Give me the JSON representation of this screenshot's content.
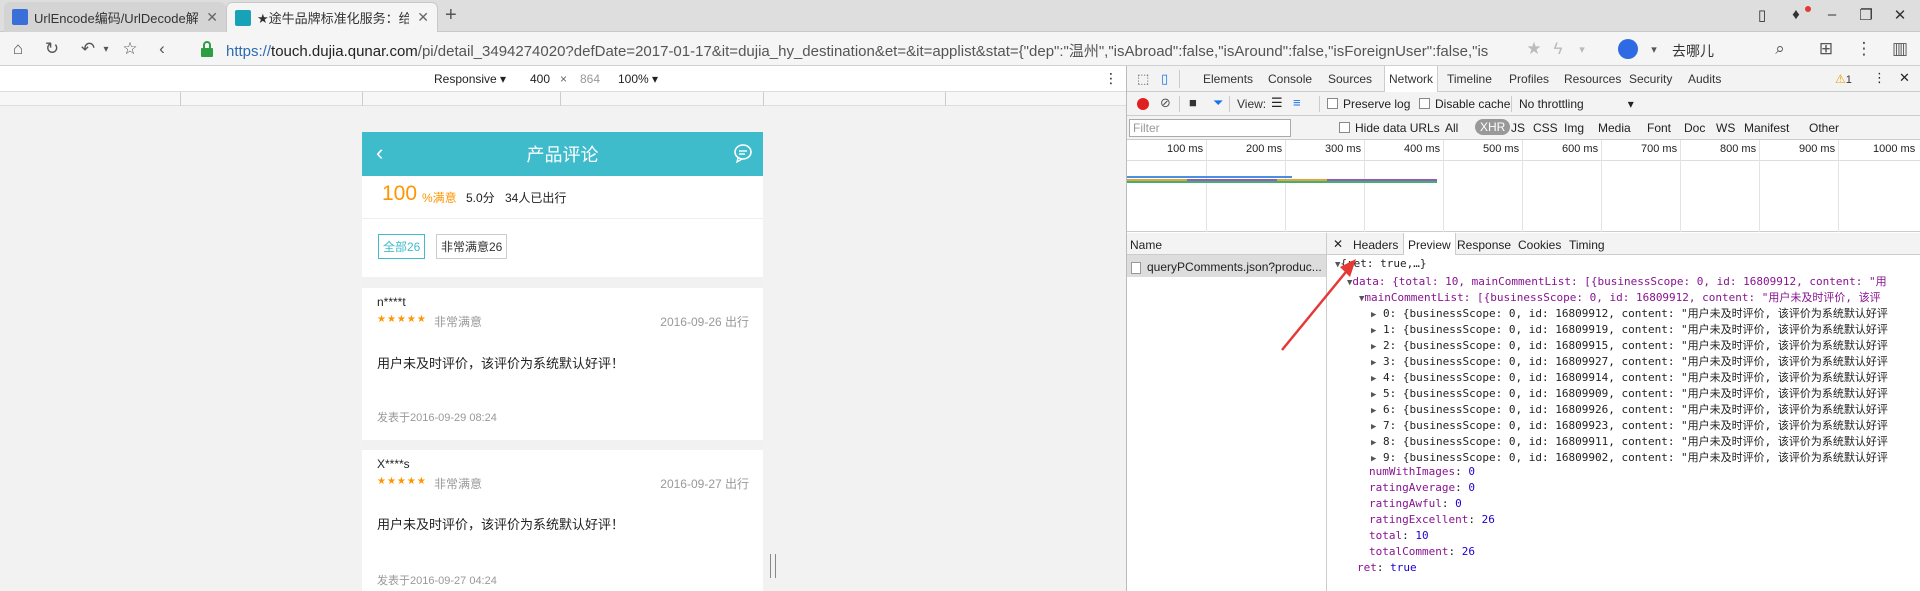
{
  "browser": {
    "tabs": [
      {
        "title": "UrlEncode编码/UrlDecode解",
        "active": false
      },
      {
        "title": "★途牛品牌标准化服务：给您",
        "active": true
      }
    ],
    "url_scheme": "https://",
    "url_domain": "touch.dujia.qunar.com",
    "url_rest": "/pi/detail_3494274020?defDate=2017-01-17&it=dujia_hy_destination&et=&it=applist&stat={\"dep\":\"温州\",\"isAbroad\":false,\"isAround\":false,\"isForeignUser\":false,\"is",
    "search_label": "去哪儿"
  },
  "device_toolbar": {
    "mode": "Responsive",
    "width": "400",
    "height": "864",
    "zoom": "100%"
  },
  "app": {
    "title": "产品评论",
    "score_percent": "100",
    "score_percent_unit": "%满意",
    "score": "5.0分",
    "travelers": "34人已出行",
    "filters": [
      "全部26",
      "非常满意26"
    ],
    "reviews": [
      {
        "user": "n****t",
        "stars": "★★★★★",
        "rating": "非常满意",
        "trip_date": "2016-09-26 出行",
        "content": "用户未及时评价，该评价为系统默认好评！",
        "posted": "发表于2016-09-29 08:24"
      },
      {
        "user": "X****s",
        "stars": "★★★★★",
        "rating": "非常满意",
        "trip_date": "2016-09-27 出行",
        "content": "用户未及时评价，该评价为系统默认好评！",
        "posted": "发表于2016-09-27 04:24"
      }
    ]
  },
  "devtools": {
    "tabs": [
      "Elements",
      "Console",
      "Sources",
      "Network",
      "Timeline",
      "Profiles",
      "Resources",
      "Security",
      "Audits"
    ],
    "active_tab": "Network",
    "warning_count": "1",
    "view_label": "View:",
    "preserve_log": "Preserve log",
    "disable_cache": "Disable cache",
    "throttling": "No throttling",
    "filter_placeholder": "Filter",
    "hide_data_urls": "Hide data URLs",
    "type_filters": [
      "All",
      "XHR",
      "JS",
      "CSS",
      "Img",
      "Media",
      "Font",
      "Doc",
      "WS",
      "Manifest",
      "Other"
    ],
    "active_type": "XHR",
    "timeline_ticks": [
      "100 ms",
      "200 ms",
      "300 ms",
      "400 ms",
      "500 ms",
      "600 ms",
      "700 ms",
      "800 ms",
      "900 ms",
      "1000 ms"
    ],
    "name_header": "Name",
    "request_name": "queryPComments.json?produc...",
    "detail_tabs": [
      "Headers",
      "Preview",
      "Response",
      "Cookies",
      "Timing"
    ],
    "active_detail_tab": "Preview",
    "preview": {
      "root": "{ret: true,…}",
      "data_line": "data: {total: 10, mainCommentList: [{businessScope: 0, id: 16809912, content: \"用",
      "main_line": "mainCommentList: [{businessScope: 0, id: 16809912, content: \"用户未及时评价, 该评",
      "items": [
        "0: {businessScope: 0, id: 16809912, content: \"用户未及时评价, 该评价为系统默认好评",
        "1: {businessScope: 0, id: 16809919, content: \"用户未及时评价, 该评价为系统默认好评",
        "2: {businessScope: 0, id: 16809915, content: \"用户未及时评价, 该评价为系统默认好评",
        "3: {businessScope: 0, id: 16809927, content: \"用户未及时评价, 该评价为系统默认好评",
        "4: {businessScope: 0, id: 16809914, content: \"用户未及时评价, 该评价为系统默认好评",
        "5: {businessScope: 0, id: 16809909, content: \"用户未及时评价, 该评价为系统默认好评",
        "6: {businessScope: 0, id: 16809926, content: \"用户未及时评价, 该评价为系统默认好评",
        "7: {businessScope: 0, id: 16809923, content: \"用户未及时评价, 该评价为系统默认好评",
        "8: {businessScope: 0, id: 16809911, content: \"用户未及时评价, 该评价为系统默认好评",
        "9: {businessScope: 0, id: 16809902, content: \"用户未及时评价, 该评价为系统默认好评"
      ],
      "fields": [
        {
          "key": "numWithImages",
          "value": "0"
        },
        {
          "key": "ratingAverage",
          "value": "0"
        },
        {
          "key": "ratingAwful",
          "value": "0"
        },
        {
          "key": "ratingExcellent",
          "value": "26"
        },
        {
          "key": "total",
          "value": "10"
        },
        {
          "key": "totalComment",
          "value": "26"
        }
      ],
      "ret_key": "ret",
      "ret_value": "true"
    }
  },
  "colors": {
    "app_header": "#3fbccc",
    "accent_orange": "#ff9500",
    "annotation_arrow": "#e53935"
  }
}
